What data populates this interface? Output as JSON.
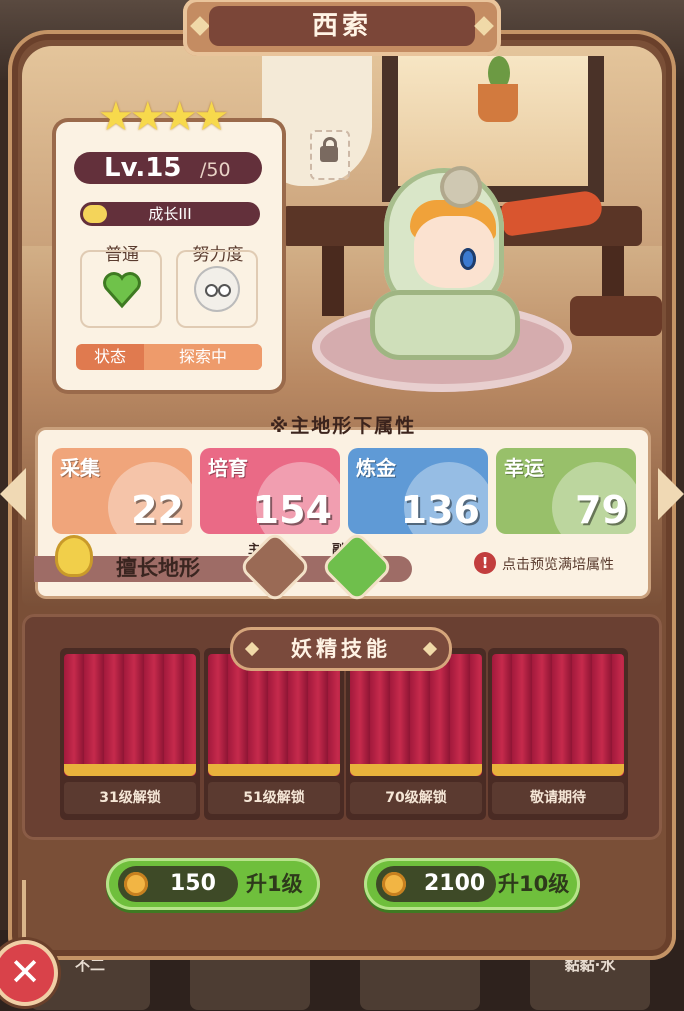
{
  "character": {
    "name": "西索",
    "stars": "★★★★",
    "level": "Lv.15",
    "level_max": "/50",
    "growth": "成长III",
    "attributes": [
      {
        "label": "普通",
        "icon": "green-heart-icon"
      },
      {
        "label": "努力度",
        "icon": "dazed-face-icon"
      }
    ],
    "status_label": "状态",
    "status_value": "探索中"
  },
  "terrain": {
    "title": "※主地形下属性",
    "stats": [
      {
        "name": "采集",
        "value": "22",
        "color": "#f0a57b"
      },
      {
        "name": "培育",
        "value": "154",
        "color": "#ea6a86"
      },
      {
        "name": "炼金",
        "value": "136",
        "color": "#5f9ad6"
      },
      {
        "name": "幸运",
        "value": "79",
        "color": "#98c06a"
      }
    ],
    "specialty_label": "擅长地形",
    "main_tag": "主",
    "sub_tag": "副",
    "preview_text": "点击预览满培属性"
  },
  "skills": {
    "title": "妖精技能",
    "slots": [
      "31级解锁",
      "51级解锁",
      "70级解锁",
      "敬请期待"
    ]
  },
  "upgrades": [
    {
      "cost": "150",
      "label": "升1级"
    },
    {
      "cost": "2100",
      "label": "升10级"
    }
  ],
  "bottom_bar": {
    "cards": [
      {
        "name": "不二",
        "stars": "★★★"
      },
      {
        "name": "",
        "stars": "★★★"
      },
      {
        "name": "",
        "stars": "★★"
      },
      {
        "name": "黏黏·水",
        "stars": "★★"
      }
    ]
  },
  "colors": {
    "frame": "#7a4f37",
    "accent_green": "#6fbf3c",
    "close_red": "#d9424a"
  }
}
